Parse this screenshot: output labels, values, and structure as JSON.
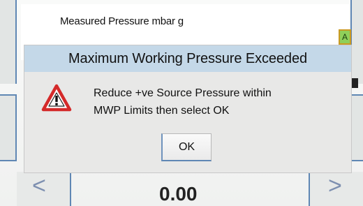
{
  "background": {
    "measured_label": "Measured Pressure   mbar g",
    "status_badge": "A",
    "bottom_value": "0.00",
    "nav_left": "<",
    "nav_right": ">"
  },
  "dialog": {
    "title": "Maximum Working Pressure Exceeded",
    "message_line1": "Reduce +ve Source Pressure within",
    "message_line2": "MWP Limits then select OK",
    "ok_label": "OK",
    "icon": "warning-icon"
  },
  "colors": {
    "title_bar": "#c4d8e8",
    "dialog_bg": "#e8e8e7",
    "accent_border": "#5f87b4",
    "warning_red": "#d42a2a",
    "badge_green": "#8fcf5a"
  }
}
